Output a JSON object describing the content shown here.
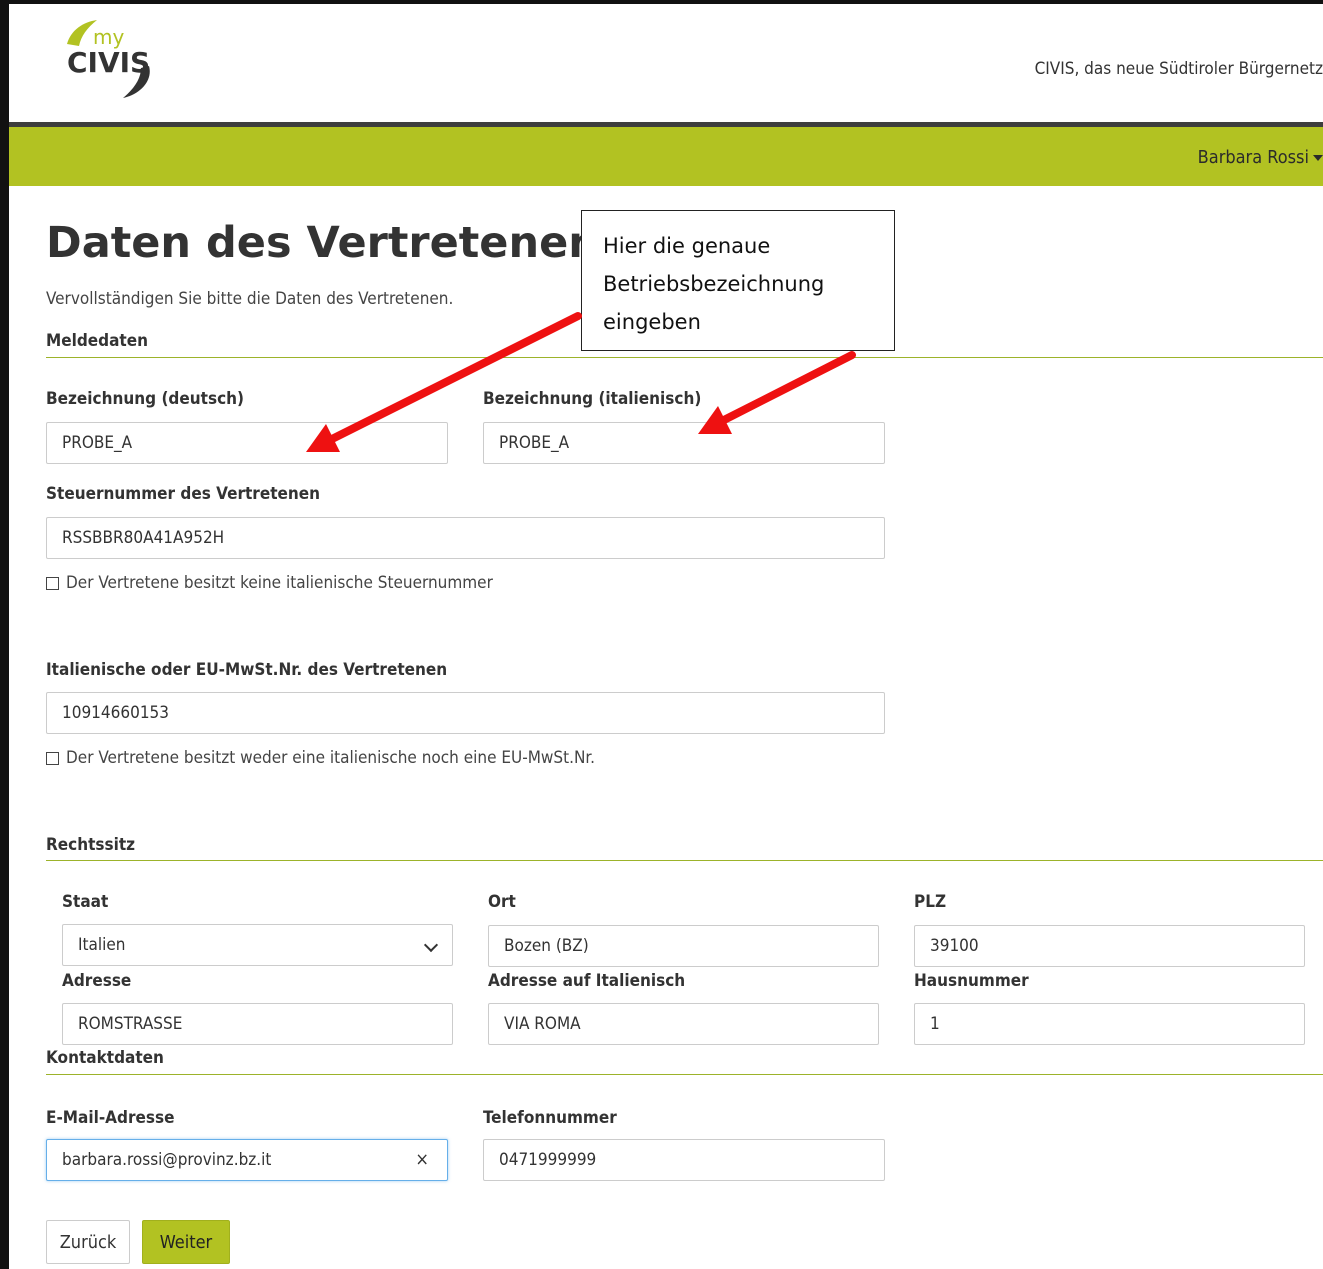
{
  "header": {
    "logo_small": "my",
    "logo_main": "CIVIS",
    "tagline": "CIVIS, das neue Südtiroler Bürgernetz"
  },
  "navbar": {
    "user": "Barbara Rossi"
  },
  "page": {
    "title": "Daten des Vertretenen",
    "intro": "Vervollständigen Sie bitte die Daten des Vertretenen."
  },
  "meldedaten": {
    "section": "Meldedaten",
    "name_de_label": "Bezeichnung (deutsch)",
    "name_de_value": "PROBE_A",
    "name_it_label": "Bezeichnung (italienisch)",
    "name_it_value": "PROBE_A",
    "taxnum_label": "Steuernummer des Vertretenen",
    "taxnum_value": "RSSBBR80A41A952H",
    "no_taxnum_checkbox": "Der Vertretene besitzt keine italienische Steuernummer",
    "vat_label": "Italienische oder EU-MwSt.Nr. des Vertretenen",
    "vat_value": "10914660153",
    "no_vat_checkbox": "Der Vertretene besitzt weder eine italienische noch eine EU-MwSt.Nr."
  },
  "rechtssitz": {
    "section": "Rechtssitz",
    "staat_label": "Staat",
    "staat_value": "Italien",
    "ort_label": "Ort",
    "ort_value": "Bozen (BZ)",
    "plz_label": "PLZ",
    "plz_value": "39100",
    "adresse_label": "Adresse",
    "adresse_value": "ROMSTRASSE",
    "adresse_it_label": "Adresse auf Italienisch",
    "adresse_it_value": "VIA ROMA",
    "hausnummer_label": "Hausnummer",
    "hausnummer_value": "1"
  },
  "kontakt": {
    "section": "Kontaktdaten",
    "email_label": "E-Mail-Adresse",
    "email_value": "barbara.rossi@provinz.bz.it",
    "clear_glyph": "×",
    "phone_label": "Telefonnummer",
    "phone_value": "0471999999"
  },
  "buttons": {
    "back": "Zurück",
    "next": "Weiter"
  },
  "callout": {
    "line1": "Hier die genaue",
    "line2": "Betriebsbezeichnung",
    "line3": "eingeben"
  },
  "colors": {
    "accent": "#b2c222",
    "arrow": "#ee1111"
  }
}
